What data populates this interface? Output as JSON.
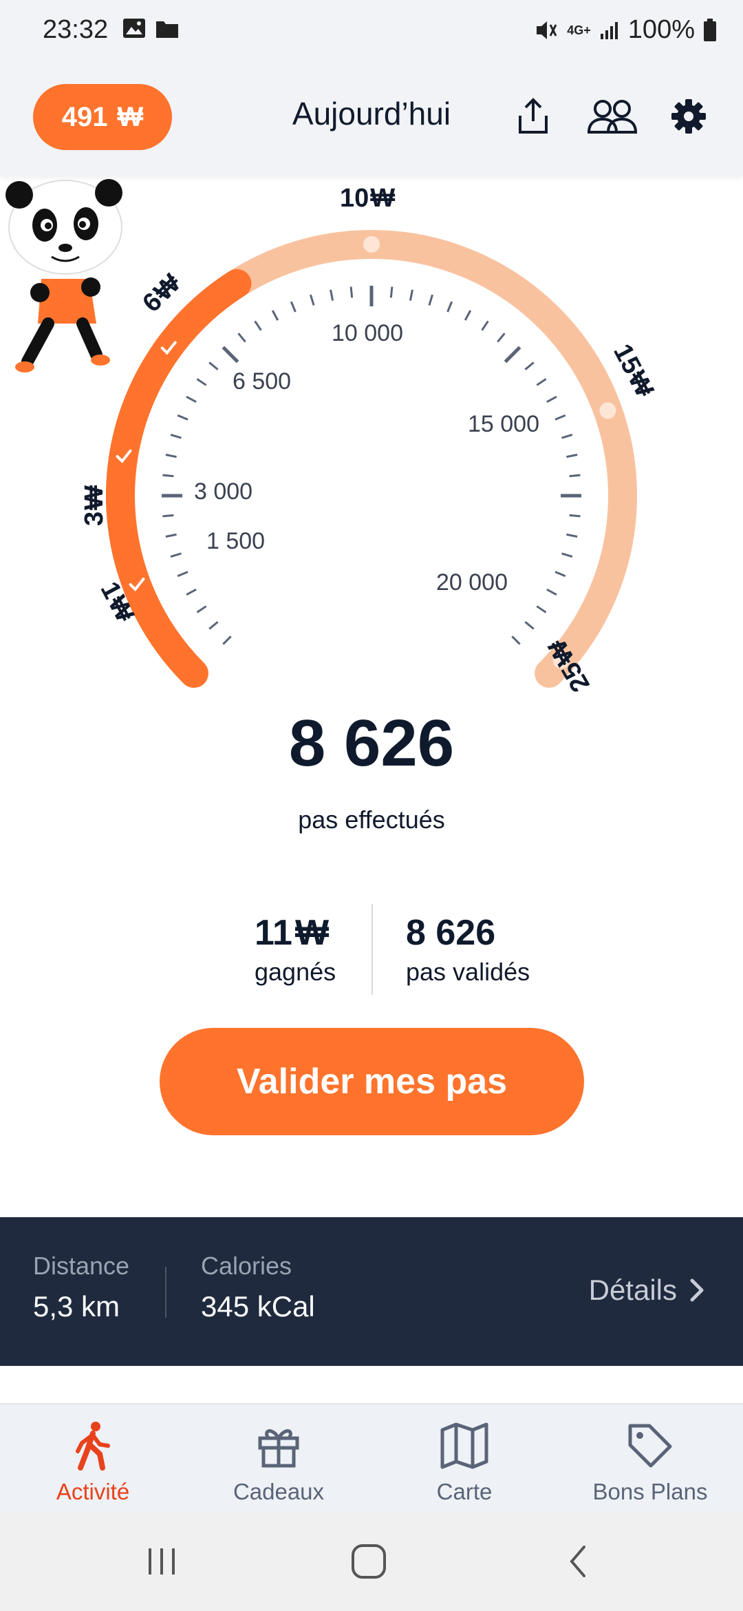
{
  "status_bar": {
    "time": "23:32",
    "left_icons": [
      "image-icon",
      "folder-icon"
    ],
    "right_icons": [
      "mute-icon",
      "network-4g-icon",
      "signal-icon"
    ],
    "network_label": "4G+",
    "battery": "100%"
  },
  "header": {
    "coins": "491",
    "coin_symbol": "₩",
    "title": "Aujourd’hui",
    "icons": [
      "share-icon",
      "friends-icon",
      "gear-icon"
    ]
  },
  "gauge": {
    "step_ticks": [
      "1 500",
      "3 000",
      "6 500",
      "10 000",
      "15 000",
      "20 000"
    ],
    "rewards": [
      "1",
      "3",
      "6",
      "10",
      "15",
      "25"
    ],
    "reward_symbol": "₩",
    "achieved_rewards": 3,
    "progress_fraction": 0.38,
    "colors": {
      "progress": "#ff732d",
      "track": "#f9c29f",
      "tick": "#5a6478"
    }
  },
  "summary": {
    "steps": "8 626",
    "steps_caption": "pas effectués",
    "earned_value": "11",
    "earned_label": "gagnés",
    "validated_value": "8 626",
    "validated_label": "pas validés",
    "cta_label": "Valider mes pas"
  },
  "details_panel": {
    "distance_label": "Distance",
    "distance_value": "5,3 km",
    "calories_label": "Calories",
    "calories_value": "345 kCal",
    "details_label": "Détails"
  },
  "bottom_nav": {
    "items": [
      {
        "label": "Activité",
        "icon": "walk-icon",
        "active": true
      },
      {
        "label": "Cadeaux",
        "icon": "gift-icon",
        "active": false
      },
      {
        "label": "Carte",
        "icon": "map-icon",
        "active": false
      },
      {
        "label": "Bons Plans",
        "icon": "tag-icon",
        "active": false
      }
    ]
  },
  "colors": {
    "accent": "#ff732d",
    "active_nav": "#e8421c",
    "dark_panel": "#1f2a3e"
  }
}
